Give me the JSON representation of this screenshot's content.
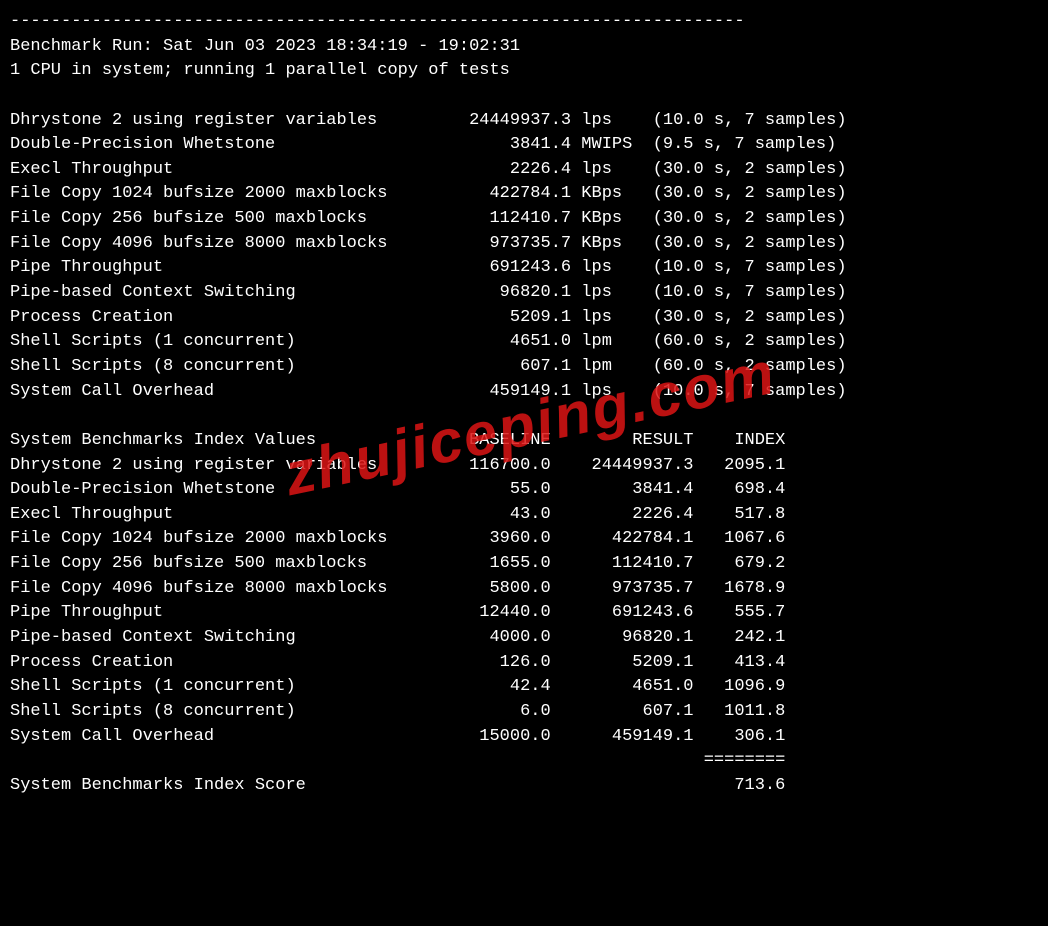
{
  "watermark": "zhujiceping.com",
  "separator": "------------------------------------------------------------------------",
  "run_header": "Benchmark Run: Sat Jun 03 2023 18:34:19 - 19:02:31",
  "cpu_info": "1 CPU in system; running 1 parallel copy of tests",
  "tests": [
    {
      "name": "Dhrystone 2 using register variables",
      "value": "24449937.3",
      "unit": "lps",
      "detail": "(10.0 s, 7 samples)"
    },
    {
      "name": "Double-Precision Whetstone",
      "value": "3841.4",
      "unit": "MWIPS",
      "detail": "(9.5 s, 7 samples)"
    },
    {
      "name": "Execl Throughput",
      "value": "2226.4",
      "unit": "lps",
      "detail": "(30.0 s, 2 samples)"
    },
    {
      "name": "File Copy 1024 bufsize 2000 maxblocks",
      "value": "422784.1",
      "unit": "KBps",
      "detail": "(30.0 s, 2 samples)"
    },
    {
      "name": "File Copy 256 bufsize 500 maxblocks",
      "value": "112410.7",
      "unit": "KBps",
      "detail": "(30.0 s, 2 samples)"
    },
    {
      "name": "File Copy 4096 bufsize 8000 maxblocks",
      "value": "973735.7",
      "unit": "KBps",
      "detail": "(30.0 s, 2 samples)"
    },
    {
      "name": "Pipe Throughput",
      "value": "691243.6",
      "unit": "lps",
      "detail": "(10.0 s, 7 samples)"
    },
    {
      "name": "Pipe-based Context Switching",
      "value": "96820.1",
      "unit": "lps",
      "detail": "(10.0 s, 7 samples)"
    },
    {
      "name": "Process Creation",
      "value": "5209.1",
      "unit": "lps",
      "detail": "(30.0 s, 2 samples)"
    },
    {
      "name": "Shell Scripts (1 concurrent)",
      "value": "4651.0",
      "unit": "lpm",
      "detail": "(60.0 s, 2 samples)"
    },
    {
      "name": "Shell Scripts (8 concurrent)",
      "value": "607.1",
      "unit": "lpm",
      "detail": "(60.0 s, 2 samples)"
    },
    {
      "name": "System Call Overhead",
      "value": "459149.1",
      "unit": "lps",
      "detail": "(10.0 s, 7 samples)"
    }
  ],
  "index_header": {
    "title": "System Benchmarks Index Values",
    "baseline": "BASELINE",
    "result": "RESULT",
    "index": "INDEX"
  },
  "index_rows": [
    {
      "name": "Dhrystone 2 using register variables",
      "baseline": "116700.0",
      "result": "24449937.3",
      "index": "2095.1"
    },
    {
      "name": "Double-Precision Whetstone",
      "baseline": "55.0",
      "result": "3841.4",
      "index": "698.4"
    },
    {
      "name": "Execl Throughput",
      "baseline": "43.0",
      "result": "2226.4",
      "index": "517.8"
    },
    {
      "name": "File Copy 1024 bufsize 2000 maxblocks",
      "baseline": "3960.0",
      "result": "422784.1",
      "index": "1067.6"
    },
    {
      "name": "File Copy 256 bufsize 500 maxblocks",
      "baseline": "1655.0",
      "result": "112410.7",
      "index": "679.2"
    },
    {
      "name": "File Copy 4096 bufsize 8000 maxblocks",
      "baseline": "5800.0",
      "result": "973735.7",
      "index": "1678.9"
    },
    {
      "name": "Pipe Throughput",
      "baseline": "12440.0",
      "result": "691243.6",
      "index": "555.7"
    },
    {
      "name": "Pipe-based Context Switching",
      "baseline": "4000.0",
      "result": "96820.1",
      "index": "242.1"
    },
    {
      "name": "Process Creation",
      "baseline": "126.0",
      "result": "5209.1",
      "index": "413.4"
    },
    {
      "name": "Shell Scripts (1 concurrent)",
      "baseline": "42.4",
      "result": "4651.0",
      "index": "1096.9"
    },
    {
      "name": "Shell Scripts (8 concurrent)",
      "baseline": "6.0",
      "result": "607.1",
      "index": "1011.8"
    },
    {
      "name": "System Call Overhead",
      "baseline": "15000.0",
      "result": "459149.1",
      "index": "306.1"
    }
  ],
  "divider": "========",
  "score_label": "System Benchmarks Index Score",
  "score_value": "713.6"
}
